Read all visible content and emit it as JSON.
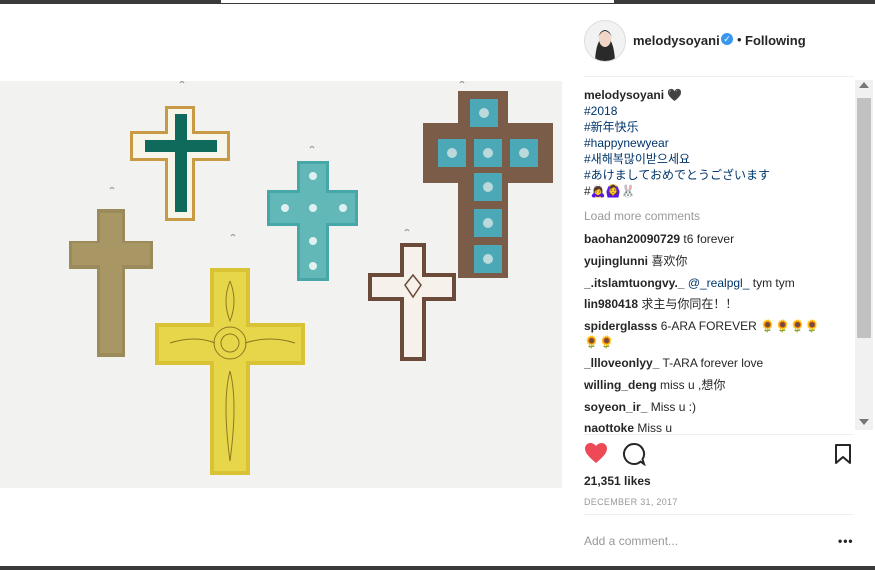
{
  "post": {
    "username": "melodysoyani",
    "separator": "•",
    "follow_status": "Following",
    "likes": "21,351 likes",
    "date": "DECEMBER 31, 2017",
    "add_comment_placeholder": "Add a comment...",
    "more": "•••"
  },
  "caption": {
    "username": "melodysoyani",
    "emoji": "🖤",
    "hashtags": [
      "#2018",
      "#新年快乐",
      "#happynewyear",
      "#새해복많이받으세요",
      "#あけましておめでとうございます"
    ],
    "emoji_line": "#🙇‍♀️🙆‍♀️🐰"
  },
  "load_more": "Load more comments",
  "comments": [
    {
      "user": "baohan20090729",
      "text": "t6 forever"
    },
    {
      "user": "yujinglunni",
      "text": "喜欢你"
    },
    {
      "user": "_.itslamtuongvy._",
      "mention": "@_realpgl_",
      "text": "tym tym"
    },
    {
      "user": "lin980418",
      "text": "求主与你同在！！"
    },
    {
      "user": "spiderglasss",
      "text": "6-ARA FOREVER 🌻🌻🌻🌻",
      "text2": "🌻🌻"
    },
    {
      "user": "_llloveonlyy_",
      "text": "T-ARA forever love"
    },
    {
      "user": "willing_deng",
      "text": "miss u ,想你"
    },
    {
      "user": "soyeon_ir_",
      "text": "Miss u :)"
    },
    {
      "user": "naottoke",
      "text": "Miss u"
    }
  ],
  "icons": {
    "like": "heart-icon",
    "comment": "comment-icon",
    "save": "bookmark-icon",
    "verified": "verified-icon"
  },
  "colors": {
    "heart": "#ed4956",
    "hashtag": "#003569",
    "verified": "#3897f0"
  }
}
